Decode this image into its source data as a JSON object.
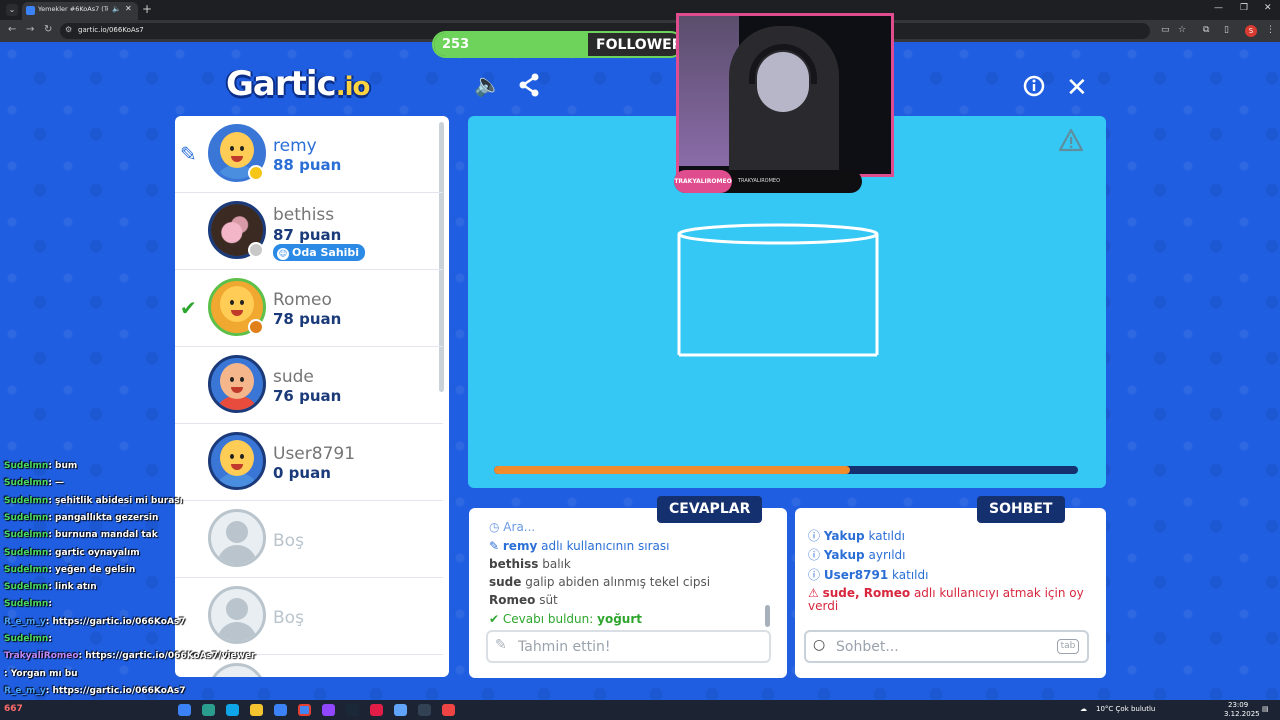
{
  "browser": {
    "tab_title": "Yemekler #6KoAs7 (Türkçe)",
    "url": "gartic.io/066KoAs7"
  },
  "header": {
    "logo": "Gartic",
    "logo_suffix": ".io"
  },
  "followers": {
    "count": "253",
    "label": "FOLLOWERS",
    "progress": 0.62
  },
  "players": [
    {
      "name": "remy",
      "score": "88 puan",
      "active": true,
      "avatar": "face-blue",
      "dot_color": "#f5c518"
    },
    {
      "name": "bethiss",
      "score": "87 puan",
      "badge": "Oda Sahibi",
      "avatar": "photo",
      "dot_color": "#c8c8c8"
    },
    {
      "name": "Romeo",
      "score": "78 puan",
      "checked": true,
      "avatar": "face-orange",
      "dot_color": "#e0801a"
    },
    {
      "name": "sude",
      "score": "76 puan",
      "avatar": "face-red"
    },
    {
      "name": "User8791",
      "score": "0 puan",
      "avatar": "face-blue"
    },
    {
      "name": "Boş",
      "empty": true
    },
    {
      "name": "Boş",
      "empty": true
    }
  ],
  "canvas": {
    "timer_progress": 0.61
  },
  "answers": {
    "title": "CEVAPLAR",
    "messages": [
      {
        "prefix": "Ara..."
      },
      {
        "user": "remy",
        "text": "adlı kullanıcının sırası"
      },
      {
        "user": "bethiss",
        "text": "balık"
      },
      {
        "user": "sude",
        "text": "galip abiden alınmış tekel cipsi"
      },
      {
        "user": "Romeo",
        "text": "süt"
      },
      {
        "text": "Cevabı buldun:",
        "answer": "yoğurt"
      }
    ],
    "input_placeholder": "Tahmin ettin!"
  },
  "chat": {
    "title": "SOHBET",
    "messages": [
      {
        "user": "Yakup",
        "text": "katıldı"
      },
      {
        "user": "Yakup",
        "text": "ayrıldı"
      },
      {
        "user": "User8791",
        "text": "katıldı"
      },
      {
        "users": "sude, Romeo",
        "text": "adlı kullanıcıyı atmak için oy",
        "text2": "verdi"
      }
    ],
    "input_placeholder": "Sohbet...",
    "tab_hint": "tab"
  },
  "stream_overlay": {
    "cam_label": "TRAKYALIROMEO",
    "cam_handle": "TRAKYALIROMEO",
    "chat": [
      {
        "user": "Sudelmn",
        "text": ": bum"
      },
      {
        "user": "Sudelmn",
        "text": ": —"
      },
      {
        "user": "Sudelmn",
        "text": ": şehitlik abidesi mi burası"
      },
      {
        "user": "Sudelmn",
        "text": ": pangallıkta gezersin"
      },
      {
        "user": "Sudelmn",
        "text": ": burnuna mandal tak"
      },
      {
        "user": "Sudelmn",
        "text": ": gartic oynayalım"
      },
      {
        "user": "Sudelmn",
        "text": ": yeğen de gelsin"
      },
      {
        "user": "Sudelmn",
        "text": ": link atın"
      },
      {
        "user": "Sudelmn",
        "text": ":"
      },
      {
        "user": "R_e_m_y",
        "text": ": https://gartic.io/066KoAs7"
      },
      {
        "user": "Sudelmn",
        "text": ":"
      },
      {
        "user": "TrakyaliRomeo",
        "text": ": https://gartic.io/066KoAs7/viewer"
      },
      {
        "user": "",
        "text": ": Yorgan mı bu"
      },
      {
        "user": "R_e_m_y",
        "text": ": https://gartic.io/066KoAs7"
      }
    ],
    "viewer_count": "667"
  },
  "taskbar": {
    "weather": "10°C  Çok bulutlu",
    "time": "23:09",
    "date": "3.12.2025"
  }
}
